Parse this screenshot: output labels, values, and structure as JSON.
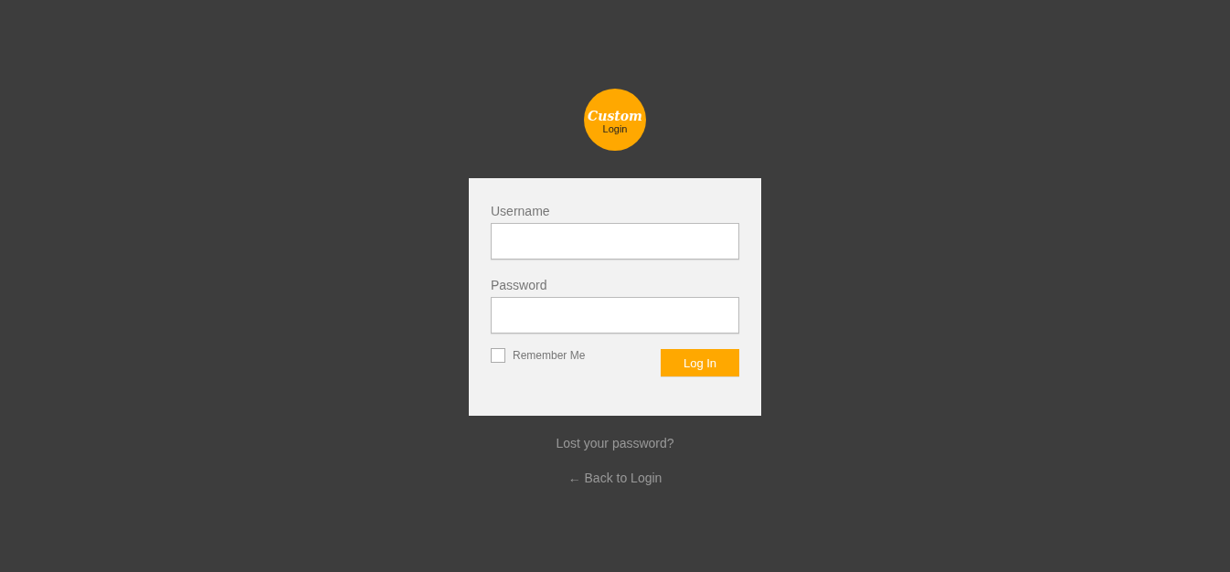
{
  "logo": {
    "script_text": "Custom",
    "text": "Login"
  },
  "form": {
    "fields": [
      {
        "label": "Username"
      },
      {
        "label": "Password"
      }
    ],
    "remember": {
      "label": "Remember Me",
      "checked": false
    },
    "submit": "Log In"
  },
  "links": [
    "Lost your password?",
    "← Back to Login"
  ]
}
